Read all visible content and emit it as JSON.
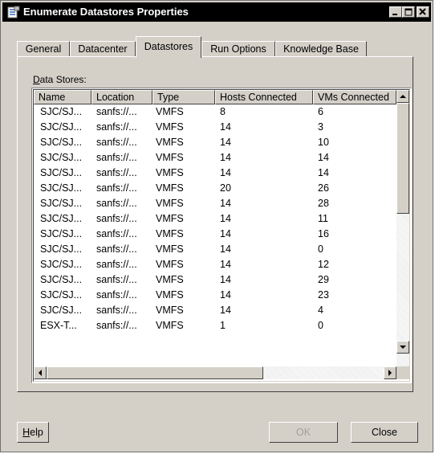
{
  "window": {
    "title": "Enumerate Datastores Properties",
    "title_icon": "properties-icon"
  },
  "tabs": [
    {
      "label": "General",
      "active": false
    },
    {
      "label": "Datacenter",
      "active": false
    },
    {
      "label": "Datastores",
      "active": true
    },
    {
      "label": "Run Options",
      "active": false
    },
    {
      "label": "Knowledge Base",
      "active": false
    }
  ],
  "data_stores": {
    "label_prefix": "D",
    "label_rest": "ata Stores:",
    "columns": [
      "Name",
      "Location",
      "Type",
      "Hosts Connected",
      "VMs Connected"
    ],
    "rows": [
      [
        "SJC/SJ...",
        "sanfs://...",
        "VMFS",
        "8",
        "6"
      ],
      [
        "SJC/SJ...",
        "sanfs://...",
        "VMFS",
        "14",
        "3"
      ],
      [
        "SJC/SJ...",
        "sanfs://...",
        "VMFS",
        "14",
        "10"
      ],
      [
        "SJC/SJ...",
        "sanfs://...",
        "VMFS",
        "14",
        "14"
      ],
      [
        "SJC/SJ...",
        "sanfs://...",
        "VMFS",
        "14",
        "14"
      ],
      [
        "SJC/SJ...",
        "sanfs://...",
        "VMFS",
        "20",
        "26"
      ],
      [
        "SJC/SJ...",
        "sanfs://...",
        "VMFS",
        "14",
        "28"
      ],
      [
        "SJC/SJ...",
        "sanfs://...",
        "VMFS",
        "14",
        "11"
      ],
      [
        "SJC/SJ...",
        "sanfs://...",
        "VMFS",
        "14",
        "16"
      ],
      [
        "SJC/SJ...",
        "sanfs://...",
        "VMFS",
        "14",
        "0"
      ],
      [
        "SJC/SJ...",
        "sanfs://...",
        "VMFS",
        "14",
        "12"
      ],
      [
        "SJC/SJ...",
        "sanfs://...",
        "VMFS",
        "14",
        "29"
      ],
      [
        "SJC/SJ...",
        "sanfs://...",
        "VMFS",
        "14",
        "23"
      ],
      [
        "SJC/SJ...",
        "sanfs://...",
        "VMFS",
        "14",
        "4"
      ],
      [
        "ESX-T...",
        "sanfs://...",
        "VMFS",
        "1",
        "0"
      ]
    ]
  },
  "buttons": {
    "help_underline": "H",
    "help_rest": "elp",
    "ok": "OK",
    "close": "Close"
  },
  "colors": {
    "titlebar": "#000000",
    "dialog_bg": "#d4d0c8"
  }
}
